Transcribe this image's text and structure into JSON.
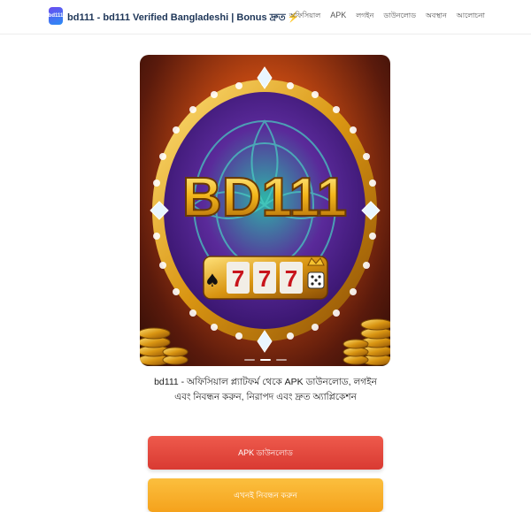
{
  "header": {
    "logo_text": "bd111",
    "site_title": "bd111 - bd111 Verified Bangladeshi | Bonus দ্রুত",
    "title_icon": "lightning-bolt-icon",
    "nav": [
      {
        "label": "অফিসিয়াল"
      },
      {
        "label": "APK"
      },
      {
        "label": "লগইন"
      },
      {
        "label": "ডাউনলোড"
      },
      {
        "label": "অবস্থান"
      },
      {
        "label": "আলোচনা"
      }
    ]
  },
  "banner": {
    "brand_text": "BD111",
    "slot_digits": [
      "7",
      "7",
      "7"
    ],
    "slides": 3,
    "active_slide": 1
  },
  "caption": "bd111 - অফিসিয়াল প্ল্যাটফর্ম থেকে APK ডাউনলোড, লগইন এবং নিবন্ধন করুন, নিরাপদ এবং দ্রুত অ্যাপ্লিকেশন",
  "buttons": {
    "apk_download": "APK ডাউনলোড",
    "register": "এখনই নিবন্ধন করুন"
  },
  "colors": {
    "primary_button": "#e0483c",
    "secondary_button": "#f7b02a",
    "title": "#1d3557"
  }
}
